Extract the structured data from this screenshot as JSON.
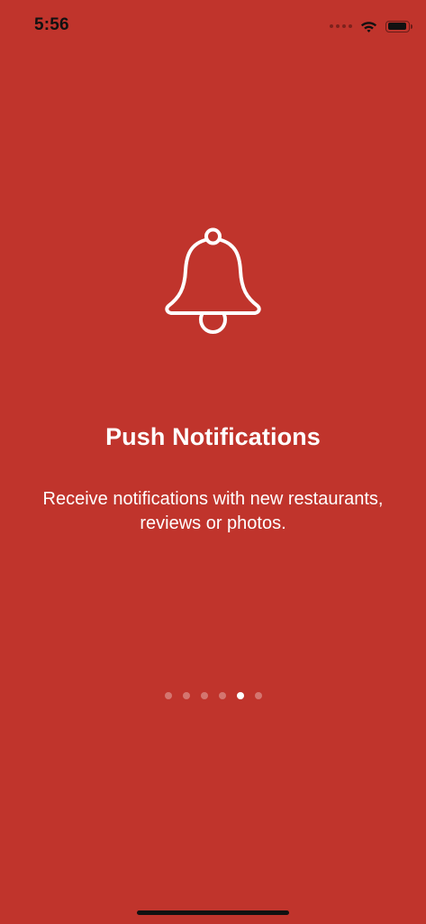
{
  "theme": {
    "background": "#C0342C",
    "text": "#FFFFFF"
  },
  "status_bar": {
    "time": "5:56"
  },
  "onboarding": {
    "icon": "bell-icon",
    "title": "Push Notifications",
    "description": "Receive notifications with new restaurants, reviews or photos.",
    "page_count": 6,
    "current_page": 5
  }
}
